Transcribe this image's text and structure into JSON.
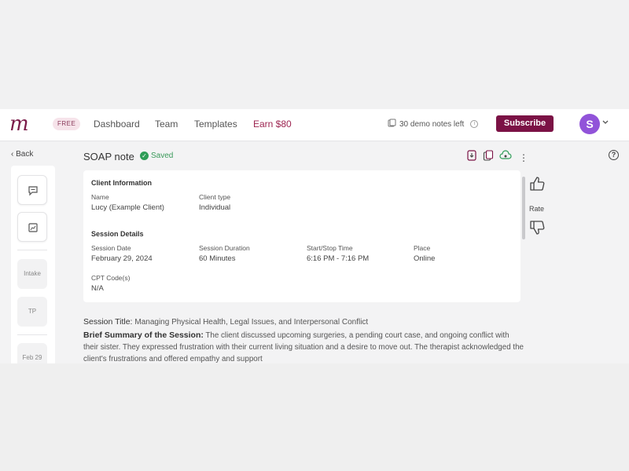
{
  "nav": {
    "logo": "m",
    "badge": "FREE",
    "links": [
      "Dashboard",
      "Team",
      "Templates"
    ],
    "earn": "Earn $80",
    "demo_notes": "30 demo notes left",
    "subscribe": "Subscribe",
    "avatar_initial": "S",
    "colors": {
      "brand": "#7b1245",
      "avatar": "#9153d9"
    }
  },
  "page": {
    "back": "Back",
    "title": "SOAP note",
    "saved": "Saved",
    "rate": "Rate"
  },
  "sidebar": {
    "tabs": [
      "Intake",
      "TP",
      "Feb 29"
    ]
  },
  "client_info": {
    "heading": "Client Information",
    "name_label": "Name",
    "name_value": "Lucy (Example Client)",
    "type_label": "Client type",
    "type_value": "Individual"
  },
  "session_details": {
    "heading": "Session Details",
    "date_label": "Session Date",
    "date_value": "February 29, 2024",
    "duration_label": "Session Duration",
    "duration_value": "60 Minutes",
    "time_label": "Start/Stop Time",
    "time_value": "6:16 PM - 7:16 PM",
    "place_label": "Place",
    "place_value": "Online",
    "cpt_label": "CPT Code(s)",
    "cpt_value": "N/A"
  },
  "note": {
    "session_title_label": "Session Title:",
    "session_title_value": "Managing Physical Health, Legal Issues, and Interpersonal Conflict",
    "summary_label": "Brief Summary of the Session:",
    "summary_text": "The client discussed upcoming surgeries, a pending court case, and ongoing conflict with their sister. They expressed frustration with their current living situation and a desire to move out. The therapist acknowledged the client's frustrations and offered empathy and support"
  }
}
